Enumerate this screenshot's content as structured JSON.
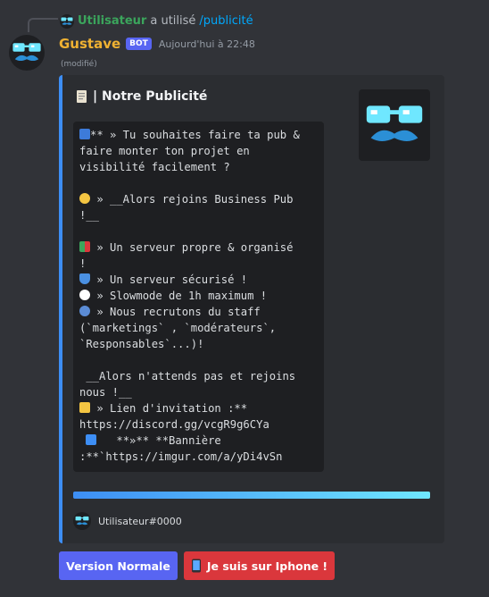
{
  "reply": {
    "user": "Utilisateur",
    "used_text": "a utilisé",
    "command": "/publicité"
  },
  "message": {
    "author": "Gustave",
    "bot_tag": "BOT",
    "timestamp": "Aujourd'hui à 22:48",
    "edited": "(modifié)"
  },
  "embed": {
    "accent_color": "#3d8ef5",
    "title": "| Notre Publicité",
    "title_icon": "scroll-icon",
    "thumbnail_icon": "glasses-mustache-logo",
    "lines": [
      "** » Tu souhaites faire ta pub &",
      "faire monter ton projet en",
      "visibilité facilement ?",
      "",
      " » __Alors rejoins Business Pub",
      "!__",
      "",
      " » Un serveur propre & organisé",
      "!",
      " » Un serveur sécurisé !",
      " » Slowmode de 1h maximum !",
      " » Nous recrutons du staff",
      "(`marketings` , `modérateurs`,",
      "`Responsables`...)!",
      "",
      " __Alors n'attends pas et rejoins",
      "nous !__",
      " » Lien d'invitation :**",
      "https://discord.gg/vcgR9g6CYa",
      "   **»** **Bannière",
      ":**`https://imgur.com/a/yDi4vSn"
    ],
    "footer_text": "Utilisateur#0000"
  },
  "buttons": {
    "normal_label": "Version Normale",
    "iphone_label": "Je suis sur Iphone !",
    "iphone_icon": "phone-icon"
  }
}
